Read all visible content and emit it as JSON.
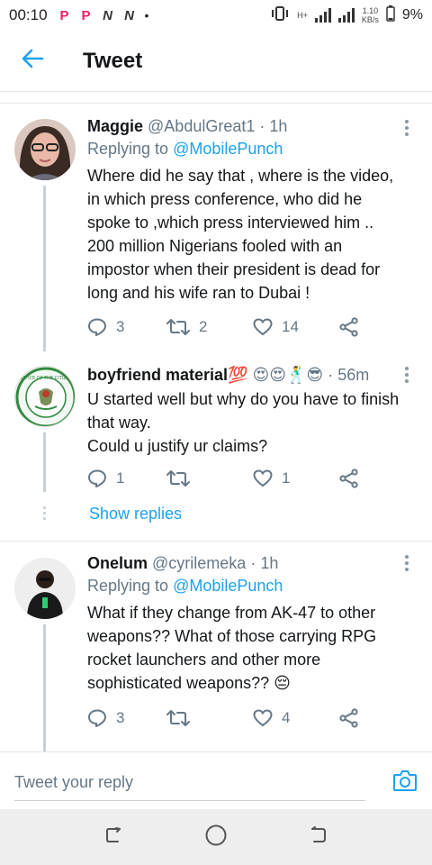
{
  "status_bar": {
    "time": "00:10",
    "apps": [
      "P",
      "P",
      "N",
      "N"
    ],
    "network_label": "H+",
    "speed_value": "1.10",
    "speed_unit": "KB/s",
    "battery": "9%"
  },
  "header": {
    "title": "Tweet",
    "back_icon": "arrow-left-icon"
  },
  "tweets": [
    {
      "name": "Maggie",
      "handle": "@AbdulGreat1",
      "time": "1h",
      "replying_prefix": "Replying to",
      "replying_to": "@MobilePunch",
      "text": "Where did he say that , where is the video,\nin which press conference, who did he\nspoke to ,which press interviewed him ..\n200 million Nigerians fooled with an\nimpostor when their president is dead for\nlong and his wife ran to Dubai !",
      "replies": "3",
      "retweets": "2",
      "likes": "14"
    },
    {
      "name": "boyfriend material",
      "name_emoji": "💯",
      "extra_emoji": "😍😍🕺😎",
      "handle": "",
      "time": "56m",
      "text": "U started well but why do you have to finish\nthat way.\nCould u justify ur claims?",
      "replies": "1",
      "retweets": "",
      "likes": "1",
      "show_replies": "Show replies"
    },
    {
      "name": "Onelum",
      "handle": "@cyrilemeka",
      "time": "1h",
      "replying_prefix": "Replying to",
      "replying_to": "@MobilePunch",
      "text": "What if they change from AK-47 to other\nweapons?? What of those carrying RPG\nrocket launchers and other more\nsophisticated weapons?? 😔",
      "replies": "3",
      "retweets": "",
      "likes": "4"
    }
  ],
  "reply_bar": {
    "placeholder": "Tweet your reply",
    "camera_icon": "camera-icon"
  },
  "colors": {
    "accent": "#1da1f2",
    "text": "#14171a",
    "muted": "#657786",
    "divider": "#e1e8ed"
  }
}
